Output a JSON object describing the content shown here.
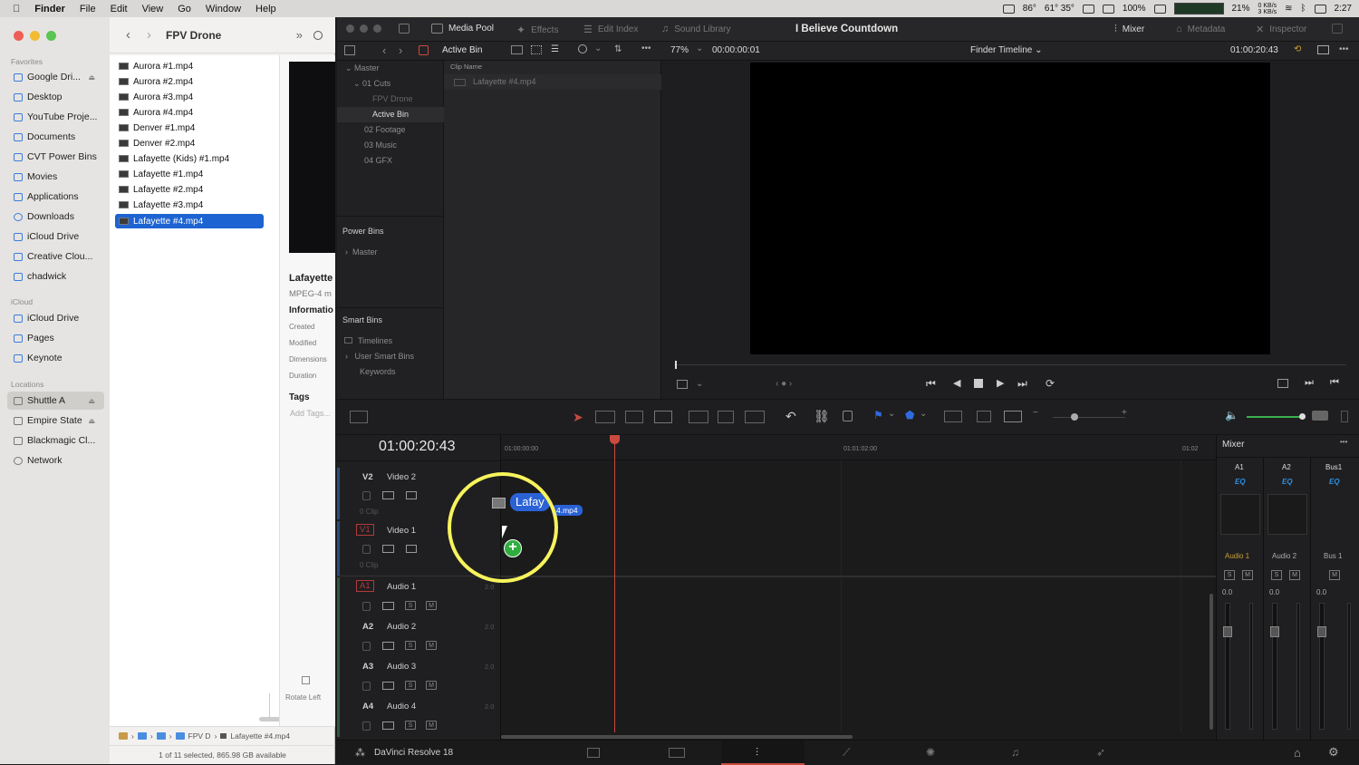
{
  "menubar": {
    "apple": "",
    "app": "Finder",
    "items": [
      "File",
      "Edit",
      "View",
      "Go",
      "Window",
      "Help"
    ],
    "status": {
      "temp1": "86°",
      "temp2": "61° 35°",
      "battery_label": "100%",
      "cpu": "21%",
      "net_up": "0 KB/s",
      "net_down": "3 KB/s",
      "clock": "2:27"
    }
  },
  "finder": {
    "title": "FPV Drone",
    "sidebar": {
      "favorites_header": "Favorites",
      "favorites": [
        "Google Dri...",
        "Desktop",
        "YouTube Proje...",
        "Documents",
        "CVT Power Bins",
        "Movies",
        "Applications",
        "Downloads",
        "iCloud Drive",
        "Creative Clou...",
        "chadwick"
      ],
      "icloud_header": "iCloud",
      "icloud": [
        "iCloud Drive",
        "Pages",
        "Keynote"
      ],
      "locations_header": "Locations",
      "locations": [
        "Shuttle A",
        "Empire State",
        "Blackmagic Cl...",
        "Network"
      ]
    },
    "files": [
      "Aurora #1.mp4",
      "Aurora #2.mp4",
      "Aurora #3.mp4",
      "Aurora #4.mp4",
      "Denver #1.mp4",
      "Denver #2.mp4",
      "Lafayette (Kids) #1.mp4",
      "Lafayette #1.mp4",
      "Lafayette #2.mp4",
      "Lafayette #3.mp4",
      "Lafayette #4.mp4"
    ],
    "selected_file": "Lafayette #4.mp4",
    "preview": {
      "name": "Lafayette",
      "kind": "MPEG-4 m",
      "info_header": "Informatio",
      "labels": [
        "Created",
        "Modified",
        "Dimensions",
        "Duration"
      ],
      "tags_header": "Tags",
      "add_tags": "Add Tags...",
      "rotate_left": "Rotate Left"
    },
    "path": [
      "FPV D",
      "Lafayette #4.mp4"
    ],
    "status": "1 of 11 selected, 865.98 GB available"
  },
  "resolve": {
    "toolbar": {
      "media_pool": "Media Pool",
      "effects": "Effects",
      "edit_index": "Edit Index",
      "sound_library": "Sound Library",
      "project": "I Believe Countdown",
      "mixer": "Mixer",
      "metadata": "Metadata",
      "inspector": "Inspector"
    },
    "bar2": {
      "active_bin": "Active Bin",
      "zoom": "77%",
      "timecode_small": "00:00:00:01",
      "timeline_name": "Finder Timeline",
      "timecode_right": "01:00:20:43"
    },
    "bins": {
      "tree": [
        "Master",
        "01 Cuts",
        "FPV Drone",
        "Active Bin",
        "02 Footage",
        "03 Music",
        "04 GFX"
      ],
      "power_bins": "Power Bins",
      "power_master": "Master",
      "smart_bins": "Smart Bins",
      "smart": [
        "Timelines",
        "User Smart Bins",
        "Keywords"
      ]
    },
    "clips": {
      "header": "Clip Name",
      "items": [
        "Lafayette #4.mp4"
      ]
    },
    "timeline": {
      "timecode": "01:00:20:43",
      "ruler": [
        "01:00:00:00",
        "01:01:02:00",
        "01:02"
      ],
      "drag_label": "Lafay",
      "drag_suffix": "4.mp4",
      "tracks": [
        {
          "id": "V2",
          "name": "Video 2",
          "count": "0 Clip"
        },
        {
          "id": "V1",
          "name": "Video 1",
          "count": "0 Clip"
        },
        {
          "id": "A1",
          "name": "Audio 1",
          "val": "2.0"
        },
        {
          "id": "A2",
          "name": "Audio 2",
          "val": "2.0"
        },
        {
          "id": "A3",
          "name": "Audio 3",
          "val": "2.0"
        },
        {
          "id": "A4",
          "name": "Audio 4",
          "val": "2.0"
        }
      ],
      "solo": "S",
      "mute": "M"
    },
    "mixer": {
      "title": "Mixer",
      "channels": [
        "A1",
        "A2",
        "Bus1"
      ],
      "eq": "EQ",
      "names": [
        "Audio 1",
        "Audio 2",
        "Bus 1"
      ],
      "level": "0.0",
      "scale": [
        "0",
        "-5",
        "-10",
        "-15",
        "-20",
        "-30",
        "-40",
        "-50"
      ]
    },
    "bottom": {
      "app": "DaVinci Resolve 18"
    }
  },
  "colors": {
    "accent_red": "#c94a3f",
    "selection_blue": "#1d63d2",
    "highlight_yellow": "#f7f35c",
    "add_green": "#2fae3f"
  }
}
